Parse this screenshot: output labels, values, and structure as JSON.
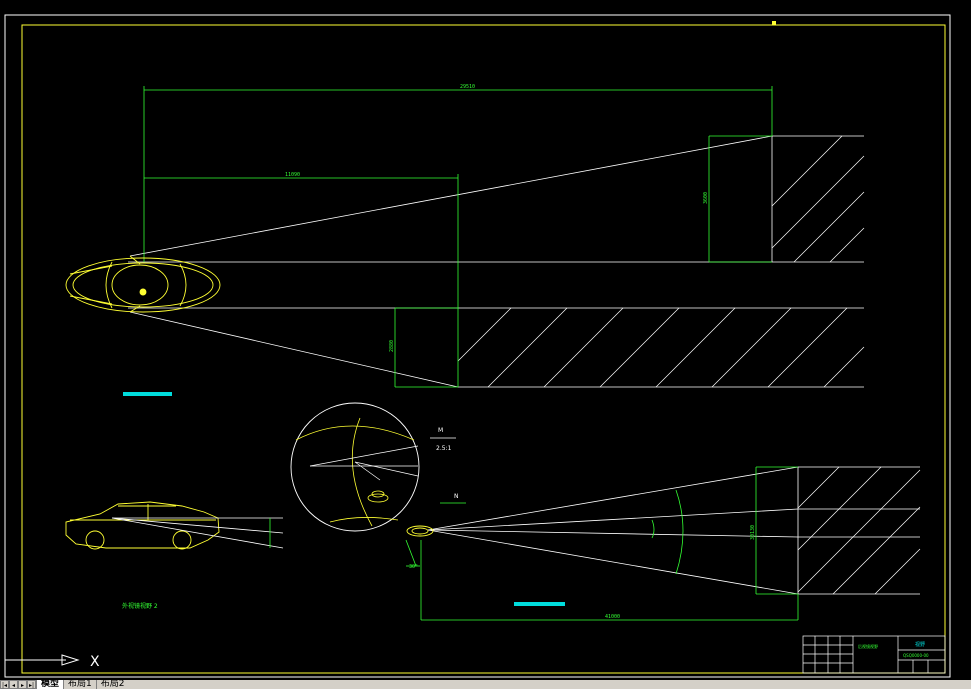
{
  "dimensions": {
    "top_total": "29510",
    "near_length": "11090",
    "far_height": "3600",
    "near_height": "2880",
    "bottom_length": "41000",
    "bottom_height": "30130"
  },
  "labels": {
    "callout_letter": "M",
    "callout_scale": "2.5:1",
    "callout_marker": "N",
    "side_view_caption": "外视镜视野 2",
    "angle_label": "30°"
  },
  "title_block": {
    "title": "视野",
    "name_field": "后视镜视野",
    "code": "QSQ0000-00"
  },
  "axis": {
    "x_label": "X"
  },
  "tabs": [
    {
      "label": "模型",
      "active": true
    },
    {
      "label": "布局1",
      "active": false
    },
    {
      "label": "布局2",
      "active": false
    }
  ],
  "colors": {
    "background": "#000000",
    "line": "#ffffff",
    "dimension": "#33ff33",
    "car": "#ffff33",
    "highlight": "#00dddd"
  }
}
